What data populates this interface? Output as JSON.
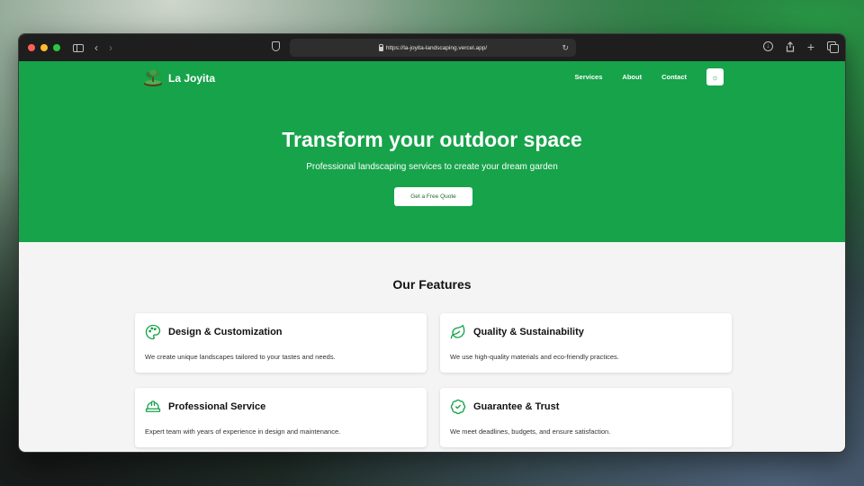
{
  "browser": {
    "url": "https://la-joyita-landscaping.vercel.app/",
    "traffic_light_colors": [
      "#ff5f57",
      "#febc2e",
      "#28c840"
    ]
  },
  "site": {
    "brand_name": "La Joyita",
    "nav": [
      {
        "label": "Services"
      },
      {
        "label": "About"
      },
      {
        "label": "Contact"
      }
    ],
    "theme_toggle_icon": "sun-icon"
  },
  "hero": {
    "title": "Transform your outdoor space",
    "subtitle": "Professional landscaping services to create your dream garden",
    "cta_label": "Get a Free Quote",
    "background_color": "#16a34a"
  },
  "features": {
    "heading": "Our Features",
    "items": [
      {
        "icon": "palette-icon",
        "title": "Design & Customization",
        "description": "We create unique landscapes tailored to your tastes and needs."
      },
      {
        "icon": "leaf-icon",
        "title": "Quality & Sustainability",
        "description": "We use high-quality materials and eco-friendly practices."
      },
      {
        "icon": "hard-hat-icon",
        "title": "Professional Service",
        "description": "Expert team with years of experience in design and maintenance."
      },
      {
        "icon": "badge-check-icon",
        "title": "Guarantee & Trust",
        "description": "We meet deadlines, budgets, and ensure satisfaction."
      }
    ]
  }
}
